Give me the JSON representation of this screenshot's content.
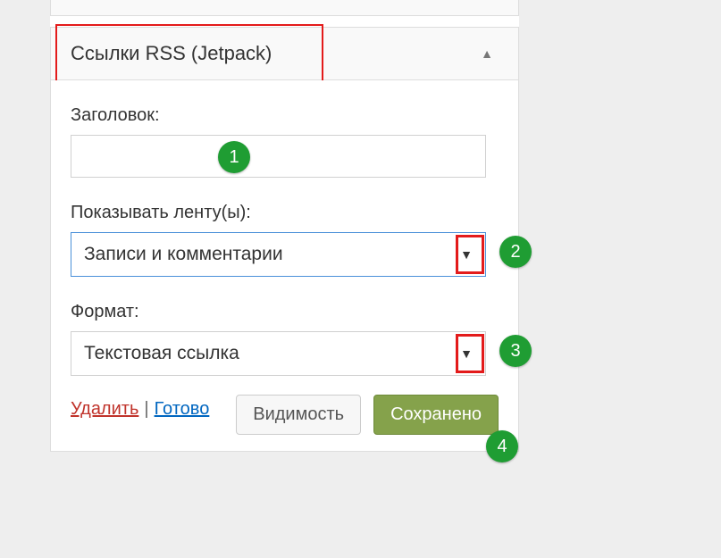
{
  "widget": {
    "title": "Ссылки RSS (Jetpack)",
    "fields": {
      "title_label": "Заголовок:",
      "title_value": "",
      "feeds_label": "Показывать ленту(ы):",
      "feeds_value": "Записи и комментарии",
      "format_label": "Формат:",
      "format_value": "Текстовая ссылка"
    },
    "actions": {
      "delete": "Удалить",
      "separator": "|",
      "done": "Готово",
      "visibility": "Видимость",
      "saved": "Сохранено"
    }
  },
  "annotations": {
    "b1": "1",
    "b2": "2",
    "b3": "3",
    "b4": "4"
  }
}
